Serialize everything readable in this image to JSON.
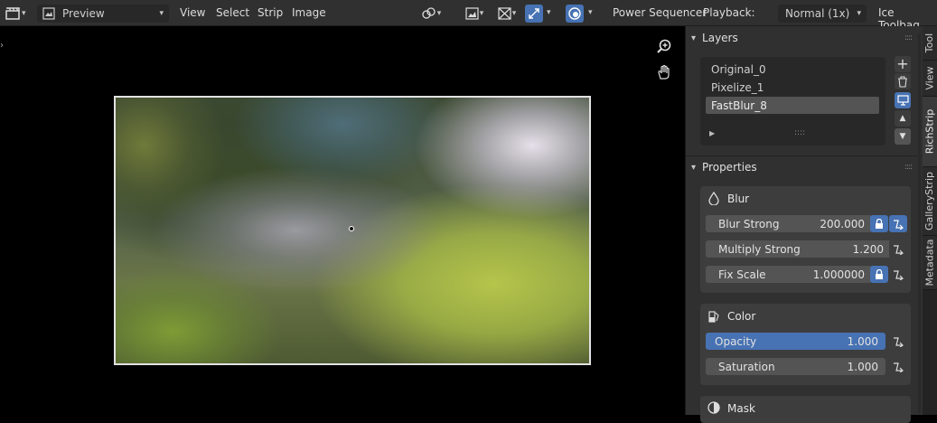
{
  "header": {
    "editor_type_icon": "sequencer-icon",
    "view_type": "Preview",
    "menus": [
      "View",
      "Select",
      "Strip",
      "Image"
    ],
    "power_sequencer": "Power Sequencer",
    "playback_label": "Playback:",
    "playback_value": "Normal (1x)",
    "ice_toolbag": "Ice Toolbag"
  },
  "viewport": {
    "zoom_icon": "zoom-icon",
    "pan_icon": "hand-icon"
  },
  "layers": {
    "title": "Layers",
    "items": [
      {
        "label": "Original_0"
      },
      {
        "label": "Pixelize_1"
      },
      {
        "label": "FastBlur_8"
      }
    ],
    "selected_index": 2
  },
  "properties": {
    "title": "Properties",
    "blur": {
      "title": "Blur",
      "rows": [
        {
          "label": "Blur Strong",
          "value": "200.000"
        },
        {
          "label": "Multiply Strong",
          "value": "1.200"
        },
        {
          "label": "Fix Scale",
          "value": "1.000000"
        }
      ]
    },
    "color": {
      "title": "Color",
      "rows": [
        {
          "label": "Opacity",
          "value": "1.000"
        },
        {
          "label": "Saturation",
          "value": "1.000"
        }
      ]
    },
    "mask": {
      "title": "Mask"
    }
  },
  "tabs": [
    "Tool",
    "View",
    "RichStrip",
    "GalleryStrip",
    "Metadata"
  ],
  "colors": {
    "accent": "#4772b3",
    "panel": "#303030",
    "field": "#545454"
  }
}
